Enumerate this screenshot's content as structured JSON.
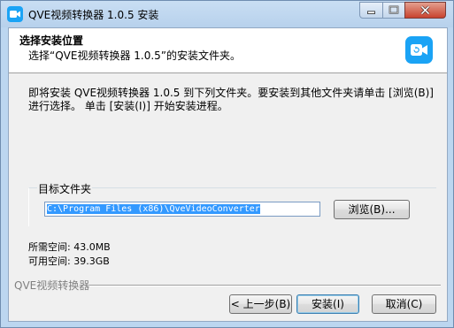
{
  "window": {
    "title": "QVE视频转换器 1.0.5 安装"
  },
  "header": {
    "title": "选择安装位置",
    "subtitle": "选择“QVE视频转换器 1.0.5”的安装文件夹。"
  },
  "intro_text": "即将安装 QVE视频转换器 1.0.5 到下列文件夹。要安装到其他文件夹请单击 [浏览(B)] 进行选择。 单击 [安装(I)] 开始安装进程。",
  "destination": {
    "group_label": "目标文件夹",
    "path": "C:\\Program Files (x86)\\QveVideoConverter",
    "browse_label": "浏览(B)..."
  },
  "space": {
    "required": "所需空间: 43.0MB",
    "available": "可用空间: 39.3GB"
  },
  "footer": {
    "brand": "QVE视频转换器",
    "back_label": "< 上一步(B)",
    "install_label": "安装(I)",
    "cancel_label": "取消(C)"
  },
  "colors": {
    "accent": "#1aa3f5",
    "selection": "#3399ff"
  },
  "icons": {
    "app": "video-camera-icon",
    "logo": "video-camera-icon"
  }
}
